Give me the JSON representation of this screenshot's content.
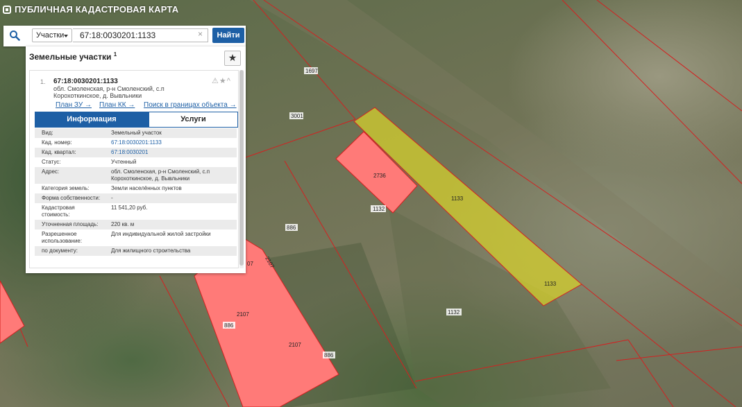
{
  "app": {
    "title": "ПУБЛИЧНАЯ КАДАСТРОВАЯ КАРТА"
  },
  "search": {
    "type_label": "Участки",
    "value": "67:18:0030201:1133",
    "clear_icon": "×",
    "button_label": "Найти"
  },
  "panel": {
    "title": "Земельные участки",
    "count": "1",
    "fav_icon": "★",
    "item": {
      "number": "1.",
      "cad_number": "67:18:0030201:1133",
      "address": "обл. Смоленская, р-н Смоленский, с.п Корохоткинское, д. Вывльники",
      "tools": "⚠★^",
      "links": [
        "План ЗУ →",
        "План КК →",
        "Поиск в границах объекта →"
      ]
    },
    "tabs": [
      "Информация",
      "Услуги"
    ],
    "properties": [
      {
        "label": "Вид:",
        "value": "Земельный участок"
      },
      {
        "label": "Кад. номер:",
        "value": "67:18:0030201:1133"
      },
      {
        "label": "Кад. квартал:",
        "value": "67:18:0030201"
      },
      {
        "label": "Статус:",
        "value": "Учтенный"
      },
      {
        "label": "Адрес:",
        "value": "обл. Смоленская, р-н Смоленский, с.п Корохоткинское, д. Вывльники"
      },
      {
        "label": "Категория земель:",
        "value": "Земли населённых пунктов"
      },
      {
        "label": "Форма собственности:",
        "value": "-"
      },
      {
        "label": "Кадастровая стоимость:",
        "value": "11 541,20 руб."
      },
      {
        "label": "Уточненная площадь:",
        "value": "220 кв. м"
      },
      {
        "label": "Разрешенное использование:",
        "value": "Для индивидуальной жилой застройки"
      },
      {
        "label": "по документу:",
        "value": "Для жилищного строительства"
      }
    ]
  },
  "map": {
    "labels": [
      "1697",
      "3001",
      "2736",
      "1132",
      "1133",
      "1133",
      "886",
      "1132",
      "2107",
      "2107",
      "886",
      "886",
      "07",
      "2107"
    ],
    "colors": {
      "highlight": "#d4cf2e",
      "parcel": "#ff7a78",
      "boundary": "#d42020"
    }
  }
}
